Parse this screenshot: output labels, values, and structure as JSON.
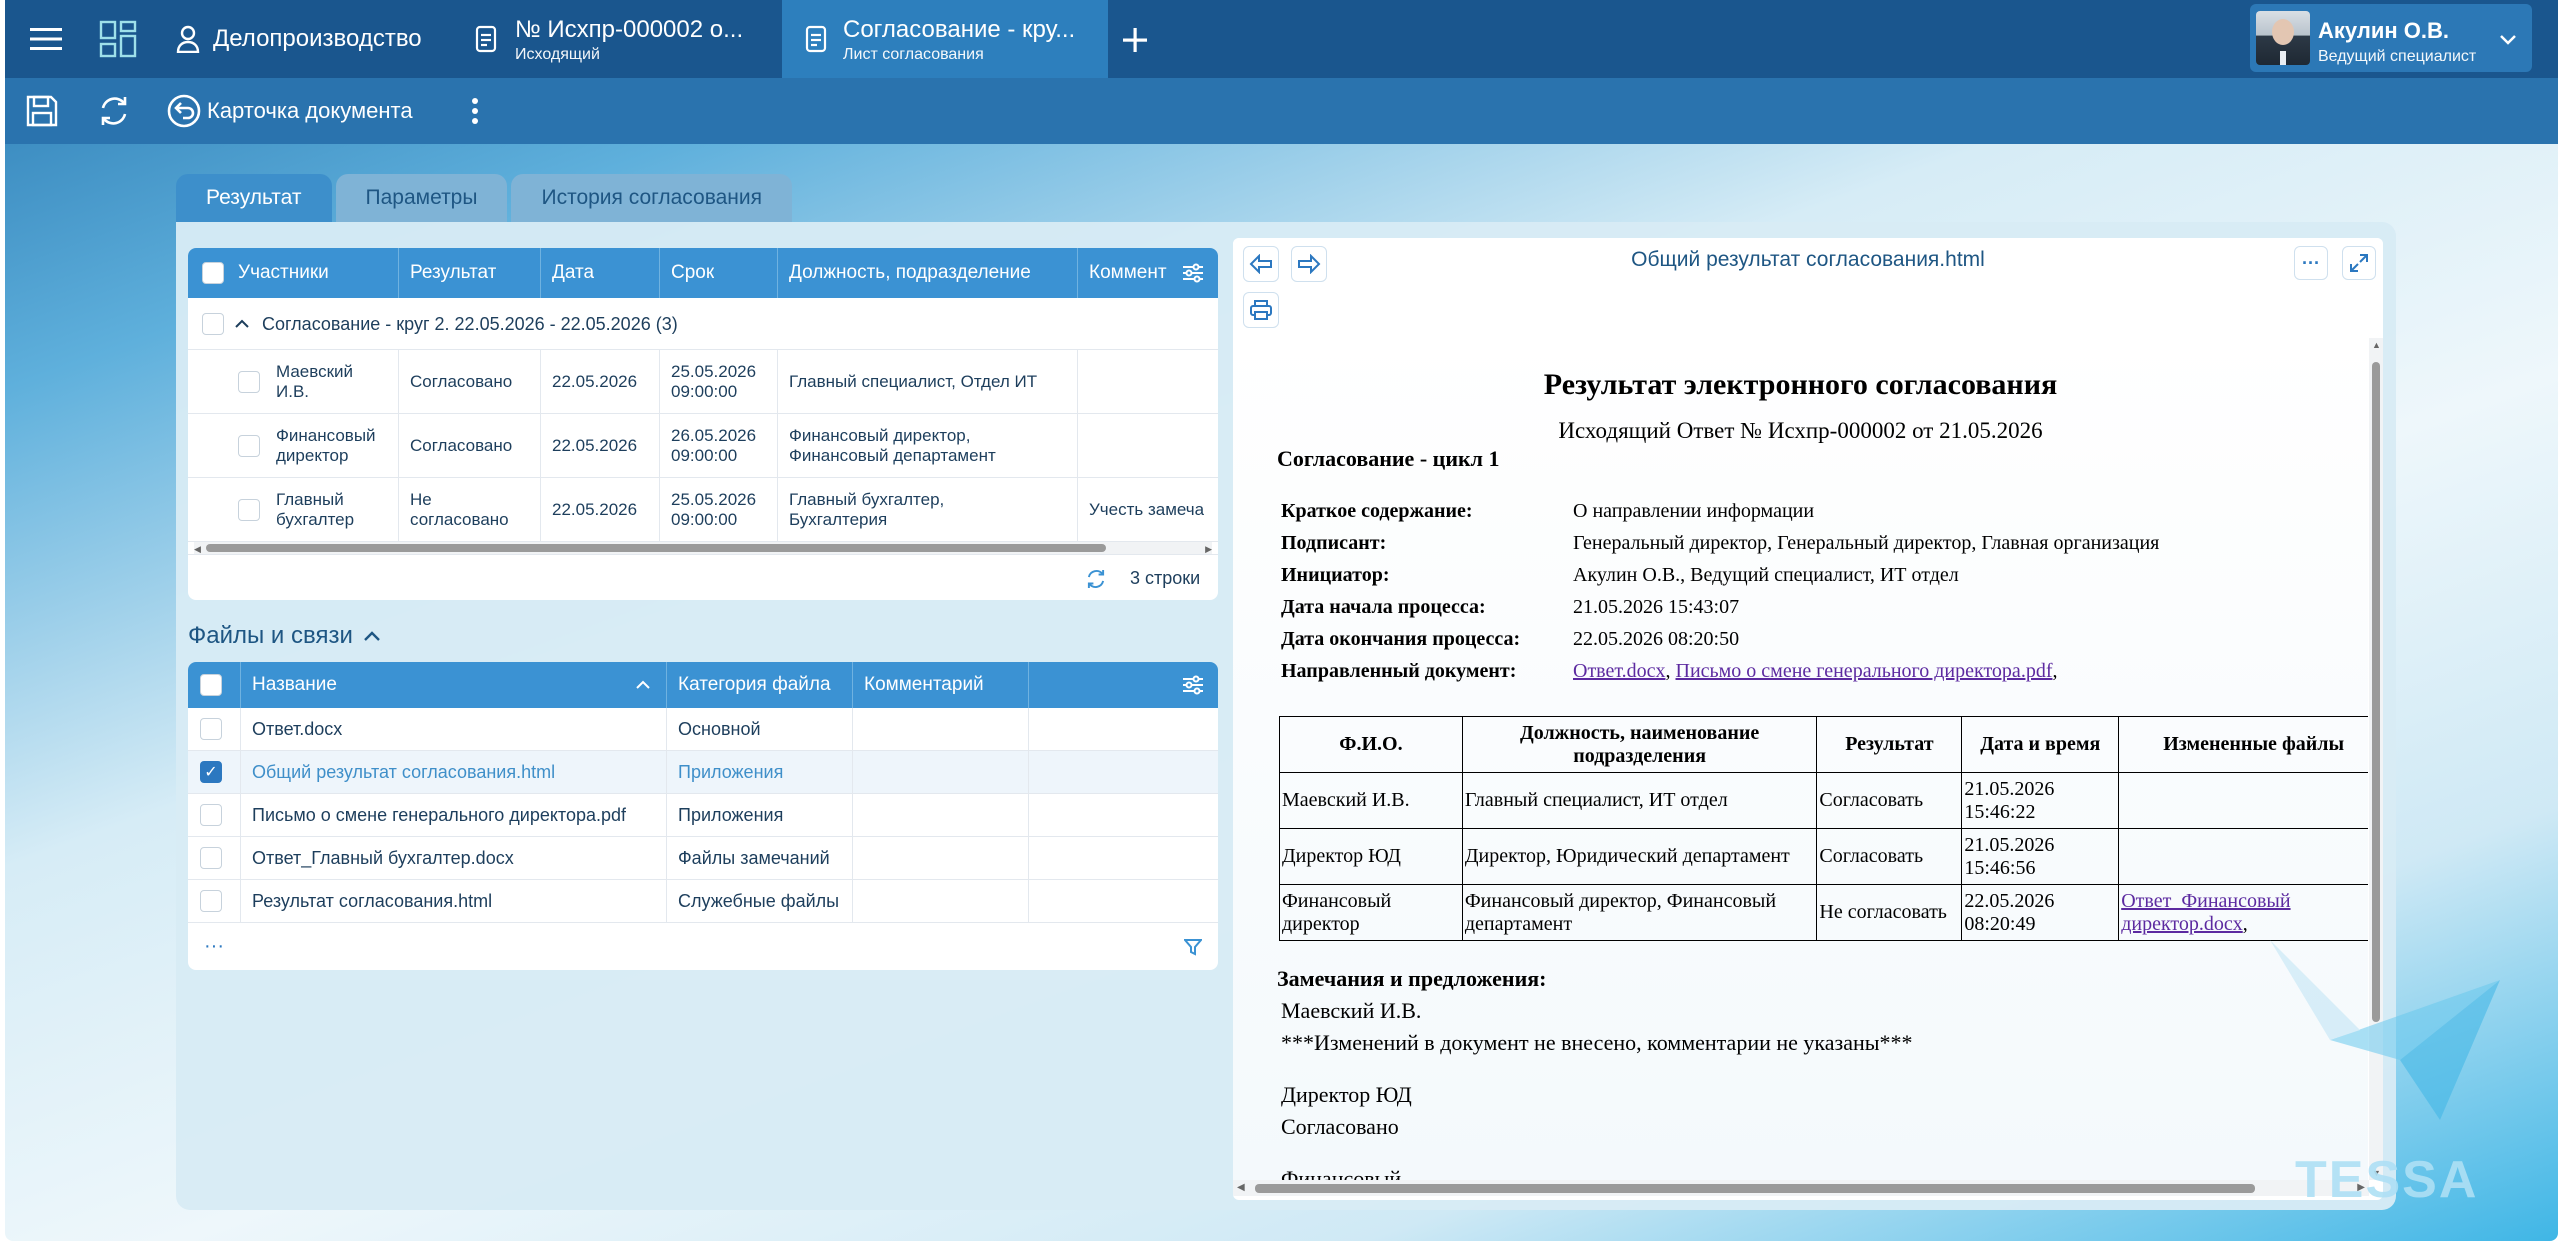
{
  "topbar": {
    "menu_icon": "hamburger-icon",
    "apps_icon": "workspace-icon",
    "section_label": "Делопроизводство",
    "tabs": [
      {
        "title": "№ Исхпр-000002 о...",
        "subtitle": "Исходящий"
      },
      {
        "title": "Согласование - кру...",
        "subtitle": "Лист согласования"
      }
    ],
    "add_icon": "plus-icon",
    "user": {
      "name": "Акулин О.В.",
      "role": "Ведущий специалист"
    }
  },
  "toolbar": {
    "save_icon": "save-icon",
    "refresh_icon": "refresh-icon",
    "card_label": "Карточка документа",
    "more_icon": "more-vertical-icon"
  },
  "page_tabs": [
    "Результат",
    "Параметры",
    "История согласования"
  ],
  "participants": {
    "columns": [
      "Участники",
      "Результат",
      "Дата",
      "Срок",
      "Должность, подразделение",
      "Коммент"
    ],
    "group": "Согласование - круг 2. 22.05.2026 - 22.05.2026 (3)",
    "rows": [
      {
        "name1": "Маевский",
        "name2": "И.В.",
        "result1": "Согласовано",
        "result2": "",
        "date": "22.05.2026",
        "due1": "25.05.2026",
        "due2": "09:00:00",
        "pos1": "Главный специалист, Отдел ИТ",
        "pos2": "",
        "comment": ""
      },
      {
        "name1": "Финансовый",
        "name2": "директор",
        "result1": "Согласовано",
        "result2": "",
        "date": "22.05.2026",
        "due1": "26.05.2026",
        "due2": "09:00:00",
        "pos1": "Финансовый директор,",
        "pos2": "Финансовый департамент",
        "comment": ""
      },
      {
        "name1": "Главный",
        "name2": "бухгалтер",
        "result1": "Не",
        "result2": "согласовано",
        "date": "22.05.2026",
        "due1": "25.05.2026",
        "due2": "09:00:00",
        "pos1": "Главный бухгалтер,",
        "pos2": "Бухгалтерия",
        "comment": "Учесть замеча"
      }
    ],
    "footer": "3 строки"
  },
  "files": {
    "heading": "Файлы и связи",
    "columns": [
      "Название",
      "Категория файла",
      "Комментарий"
    ],
    "rows": [
      {
        "name": "Ответ.docx",
        "category": "Основной",
        "checked": false
      },
      {
        "name": "Общий результат согласования.html",
        "category": "Приложения",
        "checked": true
      },
      {
        "name": "Письмо о смене генерального директора.pdf",
        "category": "Приложения",
        "checked": false
      },
      {
        "name": "Ответ_Главный бухгалтер.docx",
        "category": "Файлы замечаний",
        "checked": false
      },
      {
        "name": "Результат согласования.html",
        "category": "Служебные файлы",
        "checked": false
      }
    ],
    "more": "···"
  },
  "viewer": {
    "file_title": "Общий результат согласования.html",
    "doc": {
      "title": "Результат электронного согласования",
      "subtitle": "Исходящий Ответ № Исхпр-000002 от 21.05.2026",
      "cycle": "Согласование - цикл 1",
      "fields": [
        {
          "label": "Краткое содержание:",
          "value": "О направлении информации"
        },
        {
          "label": "Подписант:",
          "value": "Генеральный директор, Генеральный директор, Главная организация"
        },
        {
          "label": "Инициатор:",
          "value": "Акулин О.В., Ведущий специалист, ИТ отдел"
        },
        {
          "label": "Дата начала процесса:",
          "value": "21.05.2026 15:43:07"
        },
        {
          "label": "Дата окончания процесса:",
          "value": "22.05.2026 08:20:50"
        }
      ],
      "sent_label": "Направленный документ:",
      "sent_links": [
        "Ответ.docx",
        "Письмо о смене генерального директора.pdf"
      ],
      "table_headers": [
        "Ф.И.О.",
        "Должность, наименование подразделения",
        "Результат",
        "Дата и время",
        "Измененные файлы"
      ],
      "table_rows": [
        {
          "fio": "Маевский И.В.",
          "pos": "Главный специалист, ИТ отдел",
          "res": "Согласовать",
          "dt1": "21.05.2026",
          "dt2": "15:46:22",
          "file": ""
        },
        {
          "fio": "Директор ЮД",
          "pos": "Директор, Юридический департамент",
          "res": "Согласовать",
          "dt1": "21.05.2026",
          "dt2": "15:46:56",
          "file": ""
        },
        {
          "fio": "Финансовый директор",
          "pos": "Финансовый директор, Финансовый департамент",
          "res": "Не согласовать",
          "dt1": "22.05.2026",
          "dt2": "08:20:49",
          "file": "Ответ_Финансовый директор.docx"
        }
      ],
      "remarks_title": "Замечания и предложения:",
      "remarks": [
        {
          "who": "Маевский И.В.",
          "text": "***Изменений в документ не внесено, комментарии не указаны***"
        },
        {
          "who": "Директор ЮД",
          "text": "Согласовано"
        }
      ],
      "cut_text": "Финансовый"
    }
  },
  "watermark": "TESSA",
  "colors": {
    "topbar": "#1a568e",
    "toolbar": "#2a73ae",
    "grid_header": "#3b92d3",
    "accent": "#2c78c0"
  }
}
